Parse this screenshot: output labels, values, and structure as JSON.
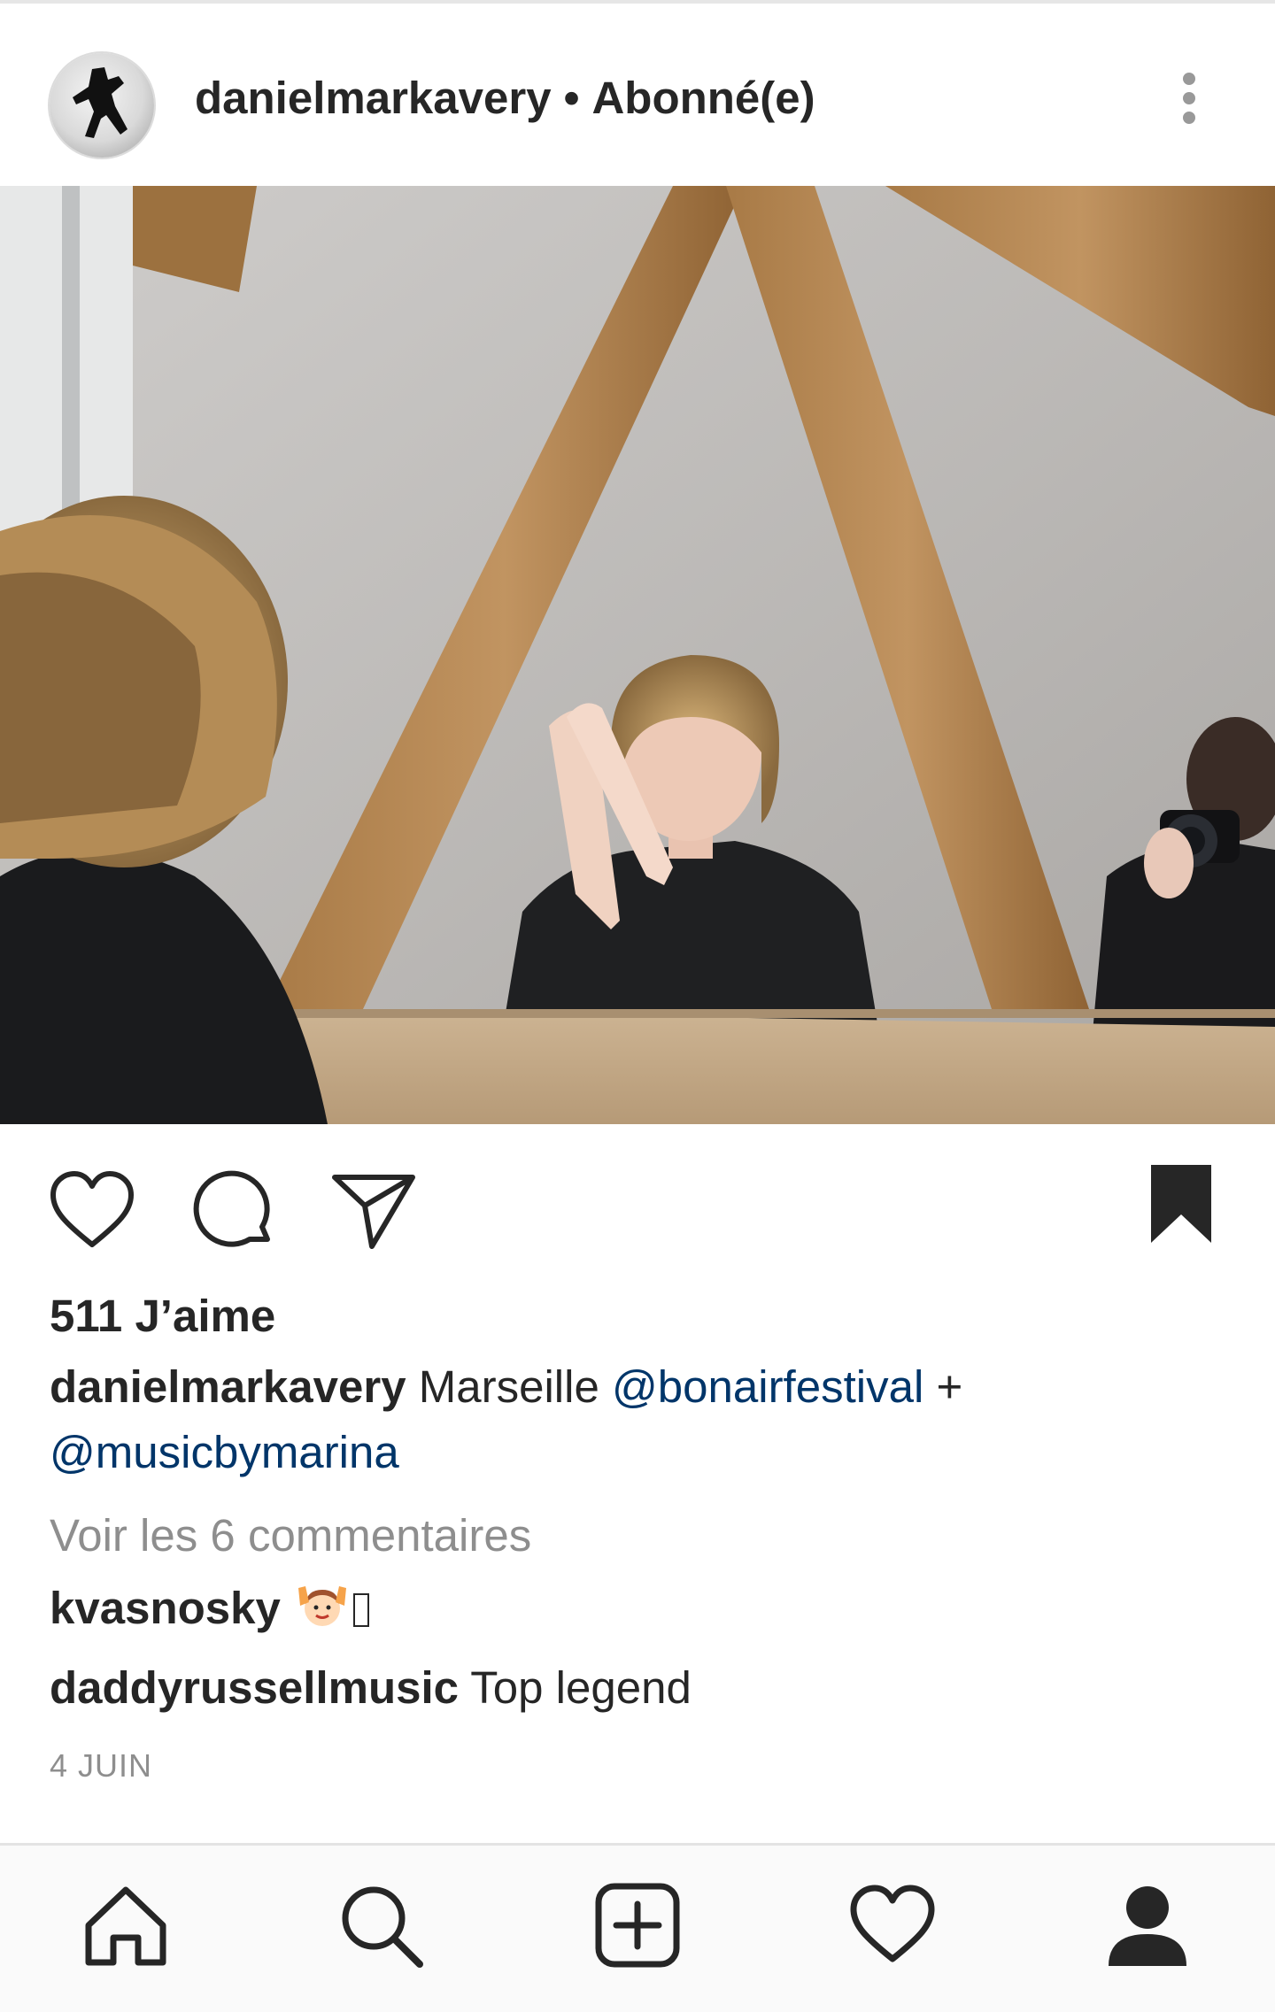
{
  "header": {
    "username": "danielmarkavery",
    "separator": "•",
    "follow_status": "Abonné(e)"
  },
  "post": {
    "likes": "511 J’aime",
    "caption": {
      "username": "danielmarkavery",
      "text": "Marseille",
      "mention1": "@bonairfestival",
      "plus": "+",
      "mention2": "@musicbymarina"
    },
    "view_comments": "Voir les 6 commentaires",
    "comments": [
      {
        "username": "kvasnosky",
        "text": ""
      },
      {
        "username": "daddyrussellmusic",
        "text": "Top legend"
      }
    ],
    "date": "4 JUIN"
  },
  "icons": {
    "more": "more-vertical-icon",
    "tag": "person-tag-icon",
    "like": "heart-outline-icon",
    "comment": "comment-bubble-icon",
    "share": "paper-plane-icon",
    "save": "bookmark-filled-icon",
    "nav": [
      "home-icon",
      "search-icon",
      "plus-square-icon",
      "heart-icon",
      "profile-filled-icon"
    ]
  },
  "colors": {
    "text": "#262626",
    "secondary": "#8e8e8e",
    "mention": "#003569",
    "nav_background": "#fafafa"
  }
}
